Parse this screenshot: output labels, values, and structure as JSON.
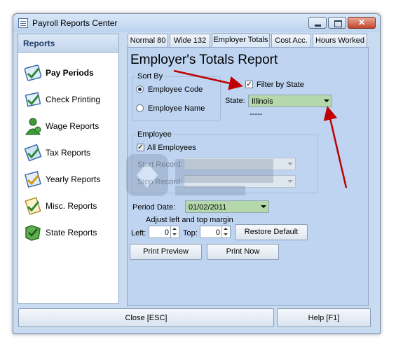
{
  "window": {
    "title": "Payroll Reports Center"
  },
  "sidebar": {
    "header": "Reports",
    "items": [
      {
        "label": "Pay Periods",
        "icon": "calendar-check-icon",
        "active": true
      },
      {
        "label": "Check Printing",
        "icon": "check-document-icon",
        "active": false
      },
      {
        "label": "Wage Reports",
        "icon": "people-group-icon",
        "active": false
      },
      {
        "label": "Tax Reports",
        "icon": "document-check-icon",
        "active": false
      },
      {
        "label": "Yearly Reports",
        "icon": "calendar-year-icon",
        "active": false
      },
      {
        "label": "Misc. Reports",
        "icon": "document-stack-icon",
        "active": false
      },
      {
        "label": "State Reports",
        "icon": "state-map-icon",
        "active": false
      }
    ]
  },
  "tabs": [
    {
      "label": "Normal 80"
    },
    {
      "label": "Wide 132"
    },
    {
      "label": "Employer Totals",
      "active": true
    },
    {
      "label": "Cost Acc."
    },
    {
      "label": "Hours Worked"
    }
  ],
  "main": {
    "title": "Employer's Totals Report",
    "sort_by": {
      "label": "Sort By",
      "options": [
        "Employee Code",
        "Employee Name"
      ],
      "selected": "Employee Code"
    },
    "filter": {
      "label": "Filter by State",
      "checked": true,
      "state_label": "State:",
      "state_value": "Illinois",
      "state_extra": "-----"
    },
    "employee": {
      "label": "Employee",
      "all_label": "All Employees",
      "all_checked": true,
      "start_label": "Start Record:",
      "stop_label": "Stop Record:"
    },
    "period": {
      "label": "Period Date:",
      "value": "01/02/2011"
    },
    "margin": {
      "title": "Adjust left and top margin",
      "left_label": "Left:",
      "left_value": "0",
      "top_label": "Top:",
      "top_value": "0",
      "restore_label": "Restore Default"
    },
    "print_preview_label": "Print Preview",
    "print_now_label": "Print Now"
  },
  "footer": {
    "close_label": "Close [ESC]",
    "help_label": "Help [F1]"
  },
  "colors": {
    "window_bg": "#c9dbf0",
    "panel_bg": "#bed4f1",
    "annotation_arrow": "#c00000",
    "state_combo": "#b4d8a9"
  }
}
